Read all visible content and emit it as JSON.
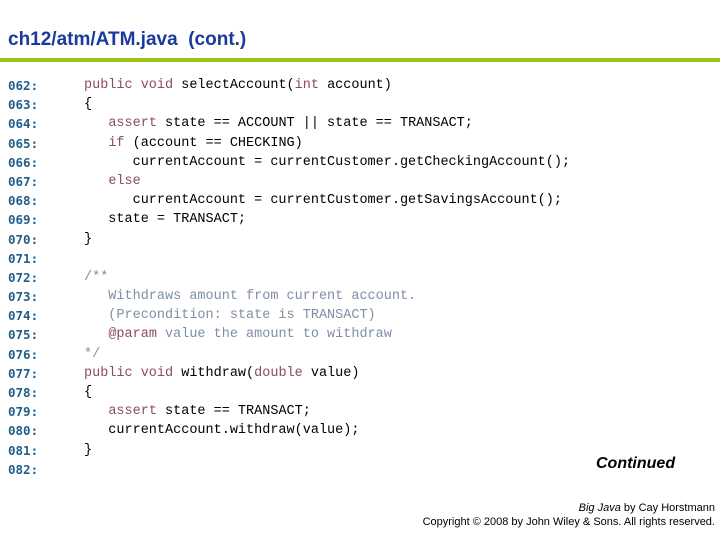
{
  "header": {
    "title": "ch12/atm/ATM.java  (cont.)",
    "rule_color": "#9bc31c",
    "title_color": "#1a3a9c"
  },
  "code": {
    "lines": [
      {
        "num": "062:",
        "tokens": [
          {
            "t": "public void",
            "c": "kw"
          },
          {
            "t": " selectAccount(",
            "c": ""
          },
          {
            "t": "int",
            "c": "kw"
          },
          {
            "t": " account)",
            "c": ""
          }
        ]
      },
      {
        "num": "063:",
        "tokens": [
          {
            "t": "{",
            "c": ""
          }
        ]
      },
      {
        "num": "064:",
        "tokens": [
          {
            "t": "   ",
            "c": ""
          },
          {
            "t": "assert",
            "c": "kw"
          },
          {
            "t": " state == ACCOUNT || state == TRANSACT;",
            "c": ""
          }
        ]
      },
      {
        "num": "065:",
        "tokens": [
          {
            "t": "   ",
            "c": ""
          },
          {
            "t": "if",
            "c": "kw"
          },
          {
            "t": " (account == CHECKING)",
            "c": ""
          }
        ]
      },
      {
        "num": "066:",
        "tokens": [
          {
            "t": "      currentAccount = currentCustomer.getCheckingAccount();",
            "c": ""
          }
        ]
      },
      {
        "num": "067:",
        "tokens": [
          {
            "t": "   ",
            "c": ""
          },
          {
            "t": "else",
            "c": "kw"
          }
        ]
      },
      {
        "num": "068:",
        "tokens": [
          {
            "t": "      currentAccount = currentCustomer.getSavingsAccount();",
            "c": ""
          }
        ]
      },
      {
        "num": "069:",
        "tokens": [
          {
            "t": "   state = TRANSACT;",
            "c": ""
          }
        ]
      },
      {
        "num": "070:",
        "tokens": [
          {
            "t": "}",
            "c": ""
          }
        ]
      },
      {
        "num": "071:",
        "tokens": []
      },
      {
        "num": "072:",
        "tokens": [
          {
            "t": "/**",
            "c": "cm"
          }
        ]
      },
      {
        "num": "073:",
        "tokens": [
          {
            "t": "   Withdraws amount from current account.",
            "c": "cm"
          }
        ]
      },
      {
        "num": "074:",
        "tokens": [
          {
            "t": "   (Precondition: state is TRANSACT)",
            "c": "cm"
          }
        ]
      },
      {
        "num": "075:",
        "tokens": [
          {
            "t": "   ",
            "c": "cm"
          },
          {
            "t": "@param",
            "c": "tag"
          },
          {
            "t": " value the amount to withdraw",
            "c": "cm"
          }
        ]
      },
      {
        "num": "076:",
        "tokens": [
          {
            "t": "*/",
            "c": "cm"
          }
        ]
      },
      {
        "num": "077:",
        "tokens": [
          {
            "t": "public void",
            "c": "kw"
          },
          {
            "t": " withdraw(",
            "c": ""
          },
          {
            "t": "double",
            "c": "kw"
          },
          {
            "t": " value)",
            "c": ""
          }
        ]
      },
      {
        "num": "078:",
        "tokens": [
          {
            "t": "{",
            "c": ""
          }
        ]
      },
      {
        "num": "079:",
        "tokens": [
          {
            "t": "   ",
            "c": ""
          },
          {
            "t": "assert",
            "c": "kw"
          },
          {
            "t": " state == TRANSACT;",
            "c": ""
          }
        ]
      },
      {
        "num": "080:",
        "tokens": [
          {
            "t": "   currentAccount.withdraw(value);",
            "c": ""
          }
        ]
      },
      {
        "num": "081:",
        "tokens": [
          {
            "t": "}",
            "c": ""
          }
        ]
      },
      {
        "num": "082:",
        "tokens": []
      }
    ]
  },
  "footer": {
    "continued": "Continued",
    "book_title": "Big Java",
    "book_author": " by Cay Horstmann",
    "copyright": "Copyright © 2008 by John Wiley & Sons.  All rights reserved."
  }
}
